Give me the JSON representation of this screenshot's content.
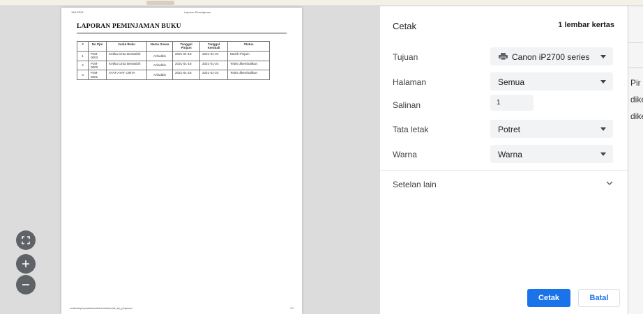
{
  "preview": {
    "page": {
      "header_date": "18/1/2021",
      "header_title": "Laporan Peminjaman",
      "title": "LAPORAN PEMINJAMAN BUKU",
      "table": {
        "headers": [
          "#",
          "No Pjm",
          "Judul Buku",
          "Nama Siswa",
          "Tanggal Pinjam",
          "Tanggal Kembali",
          "Status"
        ],
        "rows": [
          [
            "1",
            "PJM-0003",
            "Ketika Cinta Bertasbih",
            "Arifuddin",
            "2021-01-18",
            "2021-01-24",
            "Masih Pinjam"
          ],
          [
            "2",
            "PJM-0002",
            "Ketika Cinta Bertasbih",
            "Arifuddin",
            "2021-01-18",
            "2021-01-24",
            "Telah dikembalikan"
          ],
          [
            "3",
            "PJM-0001",
            "AYAT-AYAT CINTA",
            "Arifuddin",
            "2021-01-18",
            "2021-01-24",
            "Telah dikembalikan"
          ]
        ]
      },
      "footer_url": "localhost/perpustakaan/Admin/data/cetak_lap_pinjaman/",
      "page_number": "1/1"
    },
    "controls": {
      "fit_icon": "fit-to-page-icon",
      "zoom_in_icon": "plus-icon",
      "zoom_out_icon": "minus-icon"
    }
  },
  "panel": {
    "heading": "Cetak",
    "sheet_count": "1 lembar kertas",
    "destination": {
      "label": "Tujuan",
      "value": "Canon iP2700 series"
    },
    "pages": {
      "label": "Halaman",
      "value": "Semua"
    },
    "copies": {
      "label": "Salinan",
      "value": "1"
    },
    "layout": {
      "label": "Tata letak",
      "value": "Potret"
    },
    "color": {
      "label": "Warna",
      "value": "Warna"
    },
    "more_settings": "Setelan lain",
    "print_button": "Cetak",
    "cancel_button": "Batal"
  },
  "background": {
    "right_texts": [
      "Pir",
      "dike",
      "dike"
    ]
  },
  "colors": {
    "accent": "#1a73e8",
    "preview_bg": "#dcdcdc",
    "control_bg": "#5f6368"
  }
}
